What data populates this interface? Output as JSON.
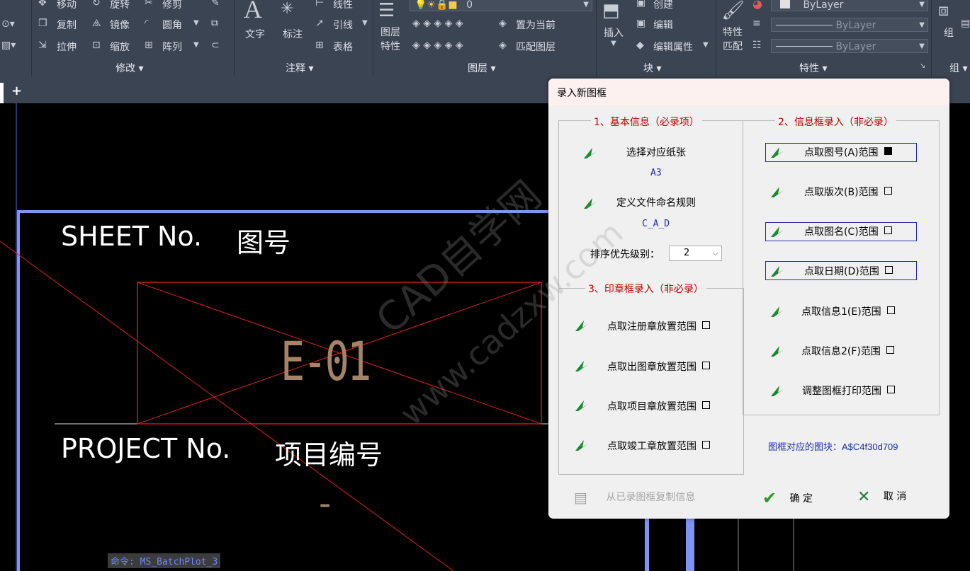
{
  "ribbon": {
    "modify": {
      "items": [
        {
          "label": "移动",
          "icon": "move-icon"
        },
        {
          "label": "旋转",
          "icon": "rotate-icon"
        },
        {
          "label": "修剪",
          "icon": "trim-icon"
        },
        {
          "label": "复制",
          "icon": "copy-icon"
        },
        {
          "label": "镜像",
          "icon": "mirror-icon"
        },
        {
          "label": "圆角",
          "icon": "fillet-icon"
        },
        {
          "label": "拉伸",
          "icon": "stretch-icon"
        },
        {
          "label": "缩放",
          "icon": "scale-icon"
        },
        {
          "label": "阵列",
          "icon": "array-icon"
        }
      ],
      "title": "修改"
    },
    "annotation": {
      "text_label": "文字",
      "dim_label": "标注",
      "linear_label": "线性",
      "leader_label": "引线",
      "table_label": "表格",
      "title": "注释"
    },
    "layers": {
      "props_label": "图层\n特性",
      "layer_value": "0",
      "set_current_label": "置为当前",
      "match_label": "匹配图层",
      "title": "图层"
    },
    "block": {
      "insert_label": "插入",
      "create_label": "创建",
      "edit_label": "编辑",
      "edit_attr_label": "编辑属性",
      "title": "块"
    },
    "properties": {
      "match_label": "特性\n匹配",
      "bylayer_1": "ByLayer",
      "bylayer_2": "ByLayer",
      "bylayer_3": "ByLayer",
      "title": "特性"
    },
    "group": {
      "label": "组",
      "title": "组"
    }
  },
  "tabs": {
    "add_label": "+"
  },
  "drawing": {
    "sheet_no_en": "SHEET No.",
    "sheet_no_cn": "图号",
    "sheet_value": "E-01",
    "project_no_en": "PROJECT No.",
    "project_no_cn": "项目编号",
    "project_value": "-",
    "watermark_1": "CAD自学网",
    "watermark_2": "www.cadzxw.com"
  },
  "command_line": "命令: MS_BatchPlot_3",
  "dialog": {
    "title": "录入新图框",
    "section1": {
      "label": "1、基本信息（必录项）",
      "select_paper": "选择对应纸张",
      "paper_value": "A3",
      "define_naming": "定义文件命名规则",
      "naming_value": "C_A_D",
      "sort_label": "排序优先级别：",
      "sort_value": "2"
    },
    "section2": {
      "label": "2、信息框录入（非必录）",
      "items": [
        {
          "label": "点取图号(A)范围",
          "checked": true,
          "highlight": true
        },
        {
          "label": "点取版次(B)范围",
          "checked": false,
          "highlight": false
        },
        {
          "label": "点取图名(C)范围",
          "checked": false,
          "highlight": true
        },
        {
          "label": "点取日期(D)范围",
          "checked": false,
          "highlight": true
        },
        {
          "label": "点取信息1(E)范围",
          "checked": false,
          "highlight": false
        },
        {
          "label": "点取信息2(F)范围",
          "checked": false,
          "highlight": false
        },
        {
          "label": "调整图框打印范围",
          "checked": false,
          "highlight": false
        }
      ]
    },
    "section3": {
      "label": "3、印章框录入（非必录）",
      "items": [
        {
          "label": "点取注册章放置范围",
          "checked": false
        },
        {
          "label": "点取出图章放置范围",
          "checked": false
        },
        {
          "label": "点取项目章放置范围",
          "checked": false
        },
        {
          "label": "点取竣工章放置范围",
          "checked": false
        }
      ]
    },
    "block_info": "图框对应的图块：A$C4f30d709",
    "copy_button": "从已录图框复制信息",
    "ok_button": "确 定",
    "cancel_button": "取 消",
    "colors": {
      "pick_icon": "#1a8a2e",
      "section_label": "#c00000",
      "value_text": "#1a2ea8",
      "ok": "#2a9a2a",
      "cancel": "#1e7a3a"
    }
  }
}
